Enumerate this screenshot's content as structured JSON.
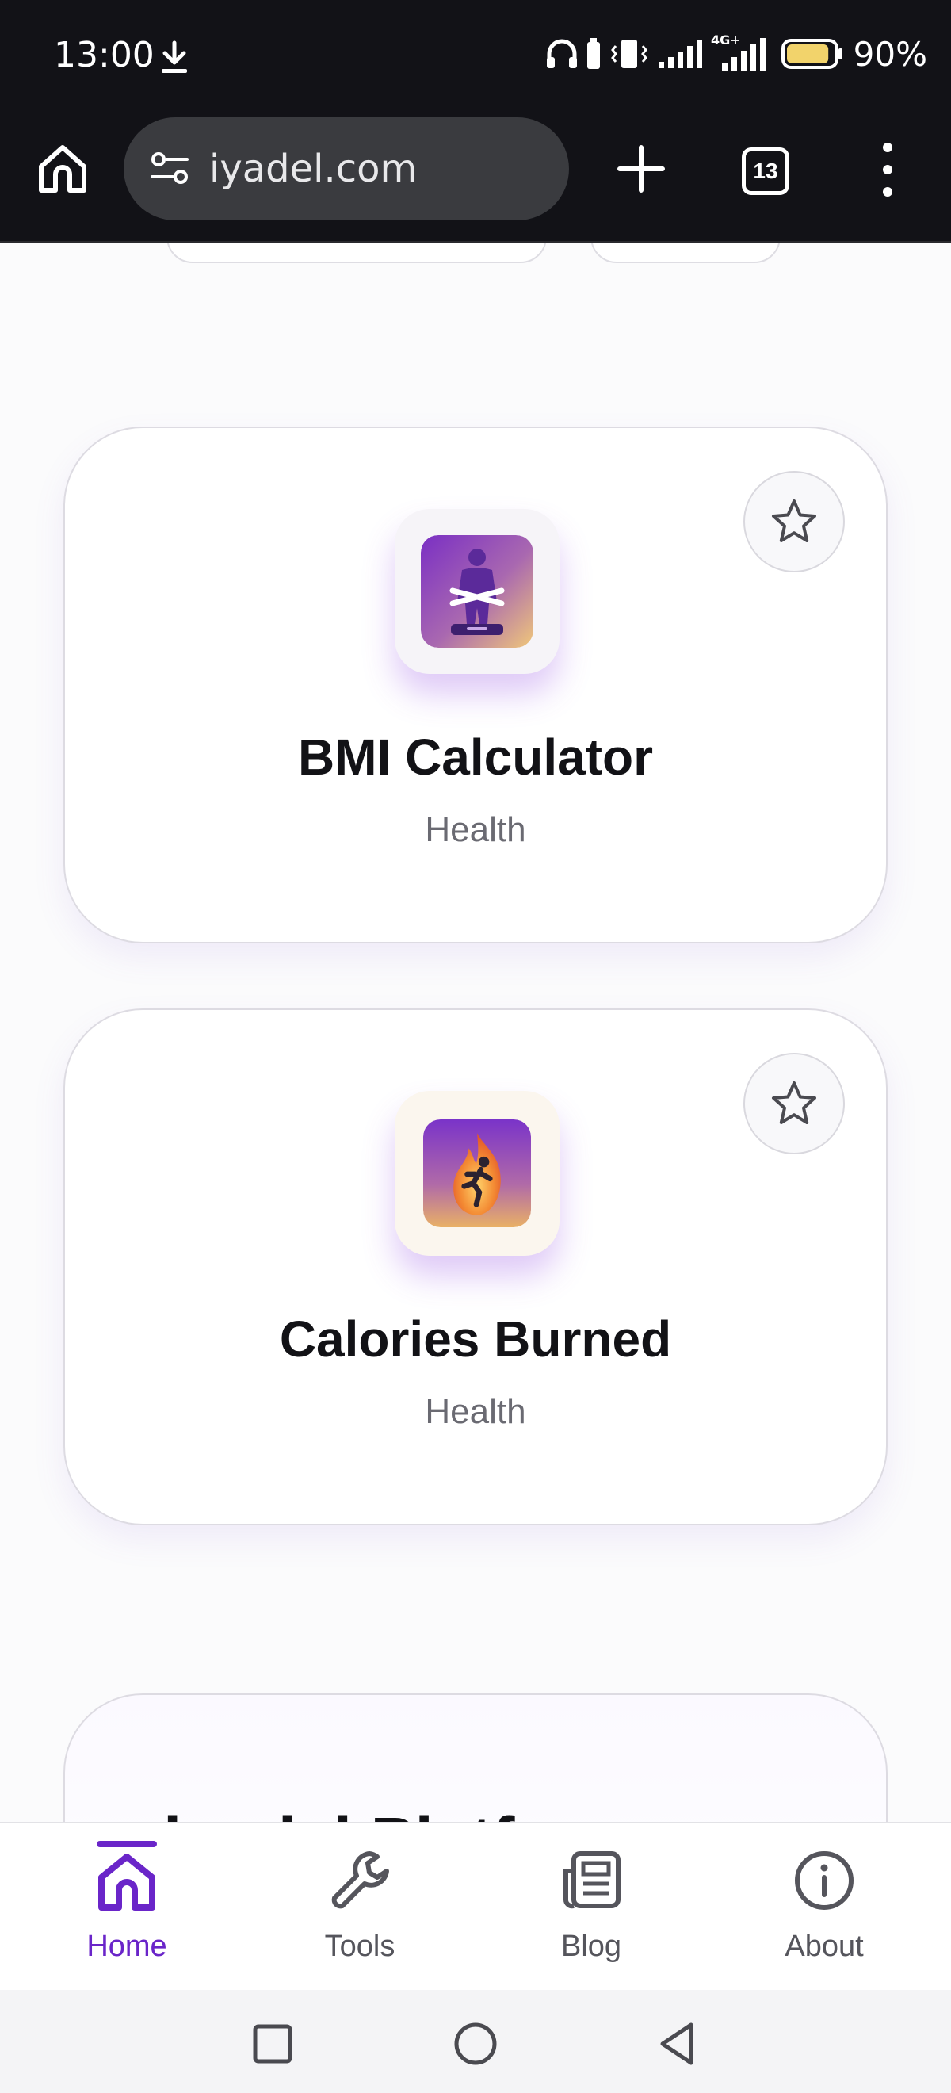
{
  "status_bar": {
    "time": "13:00",
    "network": "4G+",
    "battery_percent": "90%",
    "battery_level": 0.9,
    "icons": [
      "download-icon",
      "headphones-icon",
      "vibrate-icon",
      "signal-icon",
      "signal-4g-icon",
      "battery-icon"
    ]
  },
  "browser": {
    "url": "iyadel.com",
    "tab_count": "13",
    "icons": [
      "home-icon",
      "site-settings-icon",
      "plus-icon",
      "tabs-icon",
      "more-vert-icon"
    ]
  },
  "tools": [
    {
      "title": "BMI Calculator",
      "category": "Health",
      "icon": "bmi-scale-icon",
      "favorite": false
    },
    {
      "title": "Calories Burned",
      "category": "Health",
      "icon": "calories-flame-runner-icon",
      "favorite": false
    }
  ],
  "platform_card": {
    "heading_partial": "iyadel Platf"
  },
  "bottom_nav": {
    "items": [
      {
        "label": "Home",
        "icon": "home-icon",
        "active": true
      },
      {
        "label": "Tools",
        "icon": "wrench-icon",
        "active": false
      },
      {
        "label": "Blog",
        "icon": "newspaper-icon",
        "active": false
      },
      {
        "label": "About",
        "icon": "info-icon",
        "active": false
      }
    ]
  },
  "colors": {
    "accent": "#6a25c9",
    "status_bar_bg": "#121217",
    "battery_fill": "#f2d36b"
  }
}
